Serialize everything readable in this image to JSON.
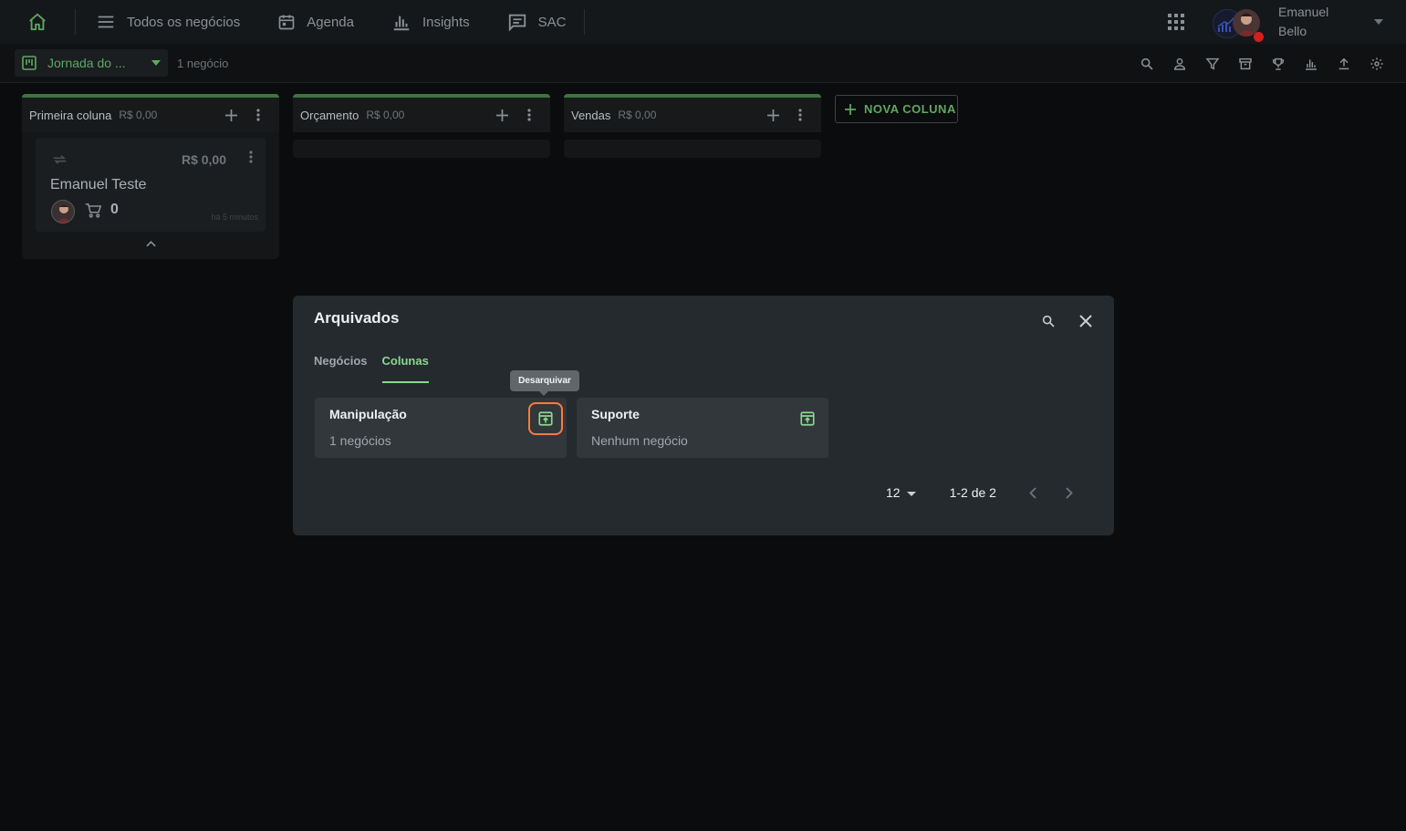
{
  "nav": {
    "items": [
      {
        "label": "Todos os negócios",
        "icon": "menu-icon"
      },
      {
        "label": "Agenda",
        "icon": "calendar-icon"
      },
      {
        "label": "Insights",
        "icon": "bar-chart-icon"
      },
      {
        "label": "SAC",
        "icon": "chat-icon"
      }
    ],
    "user": {
      "first": "Emanuel",
      "last": "Bello"
    }
  },
  "subbar": {
    "board_name": "Jornada do ...",
    "deal_count": "1 negócio"
  },
  "columns": [
    {
      "title": "Primeira coluna",
      "total": "R$ 0,00"
    },
    {
      "title": "Orçamento",
      "total": "R$ 0,00"
    },
    {
      "title": "Vendas",
      "total": "R$ 0,00"
    }
  ],
  "deal": {
    "value": "R$ 0,00",
    "name": "Emanuel Teste",
    "qty": "0",
    "time": "há 5 minutos"
  },
  "new_column_label": "NOVA COLUNA",
  "dialog": {
    "title": "Arquivados",
    "tabs": [
      {
        "label": "Negócios"
      },
      {
        "label": "Colunas",
        "active": true
      }
    ],
    "cards": [
      {
        "name": "Manipulação",
        "count": "1 negócios"
      },
      {
        "name": "Suporte",
        "count": "Nenhum negócio"
      }
    ],
    "tooltip": "Desarquivar",
    "per_page": "12",
    "range": "1-2 de 2"
  },
  "colors": {
    "accent": "#5fa862",
    "accent_light": "#88d98c",
    "focus": "#ff7a3d",
    "column_bar": "#3e7342",
    "dialog_bg": "#242a2d"
  }
}
